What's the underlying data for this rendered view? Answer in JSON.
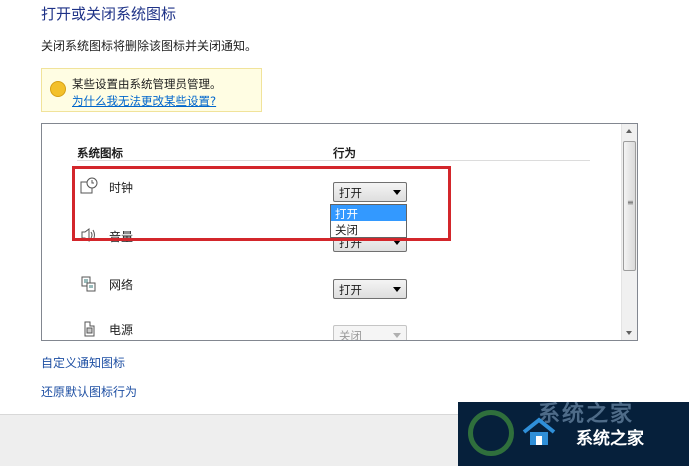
{
  "page": {
    "title": "打开或关闭系统图标",
    "description": "关闭系统图标将删除该图标并关闭通知。"
  },
  "notice": {
    "message": "某些设置由系统管理员管理。",
    "link": "为什么我无法更改某些设置?",
    "icon": "shield-icon"
  },
  "table": {
    "col_icons": "系统图标",
    "col_behavior": "行为",
    "rows": [
      {
        "label": "时钟",
        "icon": "clock-icon",
        "value": "打开",
        "enabled": true
      },
      {
        "label": "音量",
        "icon": "volume-icon",
        "value": "打开",
        "enabled": true
      },
      {
        "label": "网络",
        "icon": "network-icon",
        "value": "打开",
        "enabled": true
      },
      {
        "label": "电源",
        "icon": "power-icon",
        "value": "关闭",
        "enabled": false
      }
    ]
  },
  "dropdown": {
    "options": [
      "打开",
      "关闭"
    ],
    "highlighted": "打开"
  },
  "links": {
    "customize": "自定义通知图标",
    "restore": "还原默认图标行为"
  },
  "watermark": {
    "text": "系统之家",
    "ghost_text": "系统之家"
  },
  "colors": {
    "highlight_box": "#d3262b",
    "selection": "#3399ff",
    "link": "#1e4fa3",
    "title": "#1e3287"
  }
}
